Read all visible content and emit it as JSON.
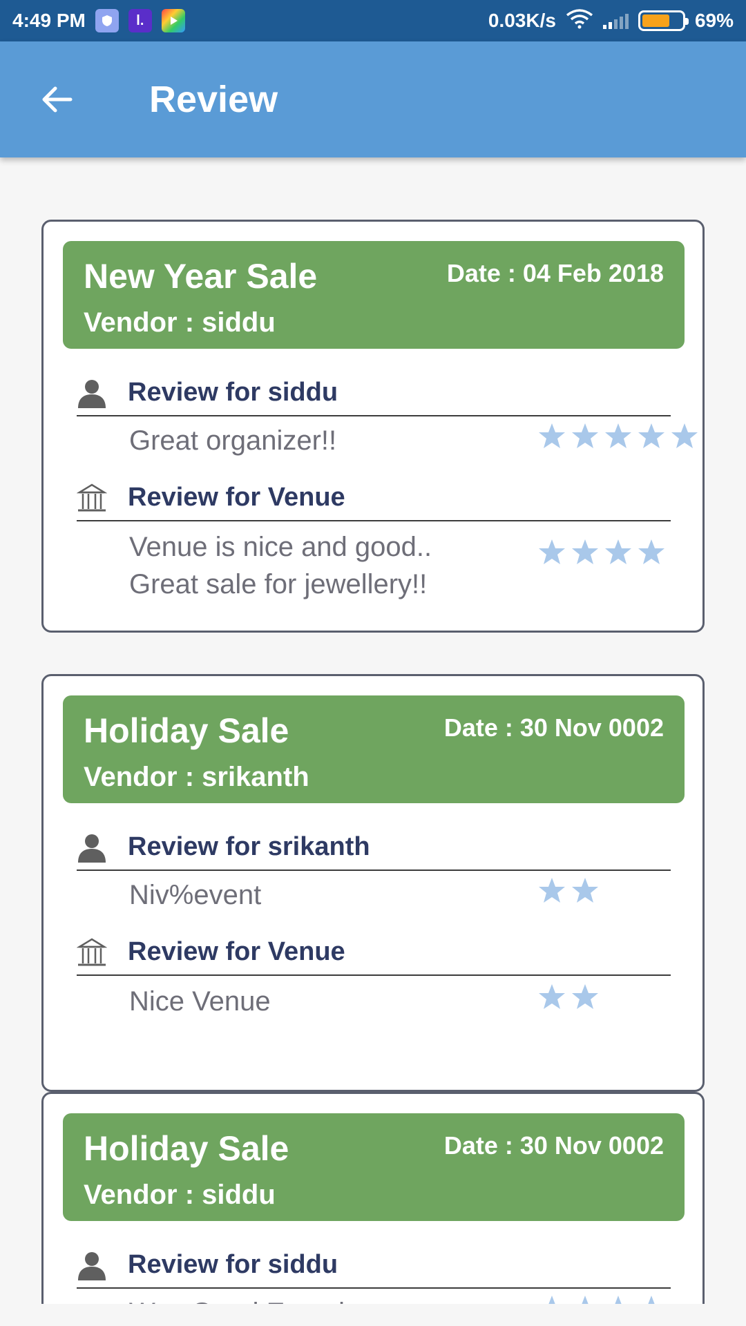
{
  "status_bar": {
    "time": "4:49 PM",
    "network_speed": "0.03K/s",
    "battery_percent": "69%",
    "battery_level": 0.69,
    "app_icons": [
      "shield-app-icon",
      "l-app-icon",
      "play-games-icon"
    ]
  },
  "app_bar": {
    "title": "Review",
    "back_icon": "arrow-left-icon"
  },
  "colors": {
    "status_bar": "#1e5a93",
    "app_bar": "#5a9bd6",
    "card_header": "#6fa55f",
    "label_text": "#2e3a63",
    "review_text": "#6e6e78",
    "star": "#a9c8ea"
  },
  "cards": [
    {
      "title": "New Year Sale",
      "vendor": "Vendor : siddu",
      "date": "Date : 04 Feb 2018",
      "vendor_review": {
        "label": "Review for siddu",
        "text": "Great organizer!!",
        "rating": 5
      },
      "venue_review": {
        "label": "Review for Venue",
        "text": "Venue is nice and good.. Great sale for jewellery!!",
        "rating": 4
      }
    },
    {
      "title": "Holiday Sale",
      "vendor": "Vendor : srikanth",
      "date": "Date : 30 Nov 0002",
      "vendor_review": {
        "label": "Review for srikanth",
        "text": "Niv%event",
        "rating": 2
      },
      "venue_review": {
        "label": "Review for Venue",
        "text": "Nice Venue",
        "rating": 2
      }
    },
    {
      "title": "Holiday Sale",
      "vendor": "Vendor : siddu",
      "date": "Date : 30 Nov 0002",
      "vendor_review": {
        "label": "Review for siddu",
        "text": "Was Good Experience",
        "rating": 4
      }
    }
  ]
}
